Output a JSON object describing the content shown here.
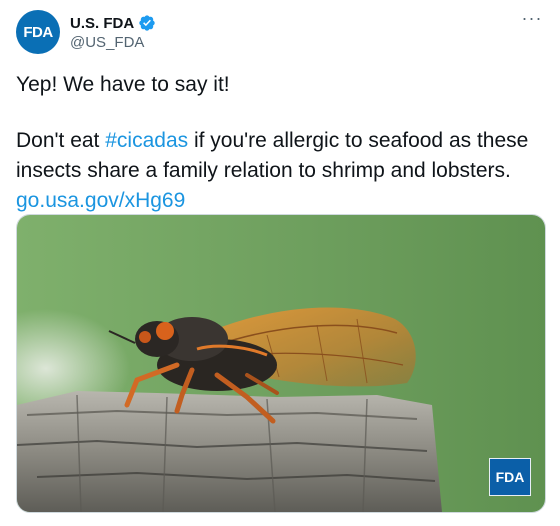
{
  "header": {
    "avatar_text": "FDA",
    "display_name": "U.S. FDA",
    "handle": "@US_FDA",
    "verified_icon": "verified-badge-icon",
    "more_icon": "more-options-icon"
  },
  "tweet": {
    "line1": "Yep! We have to say it!",
    "line2_prefix": "Don't eat ",
    "hashtag": "#cicadas",
    "line2_suffix": " if you're allergic to seafood as these insects share a family relation to shrimp and lobsters.",
    "link": "go.usa.gov/xHg69"
  },
  "media": {
    "watermark": "FDA"
  },
  "colors": {
    "link": "#1b95e0",
    "brand": "#0b5fa8"
  }
}
